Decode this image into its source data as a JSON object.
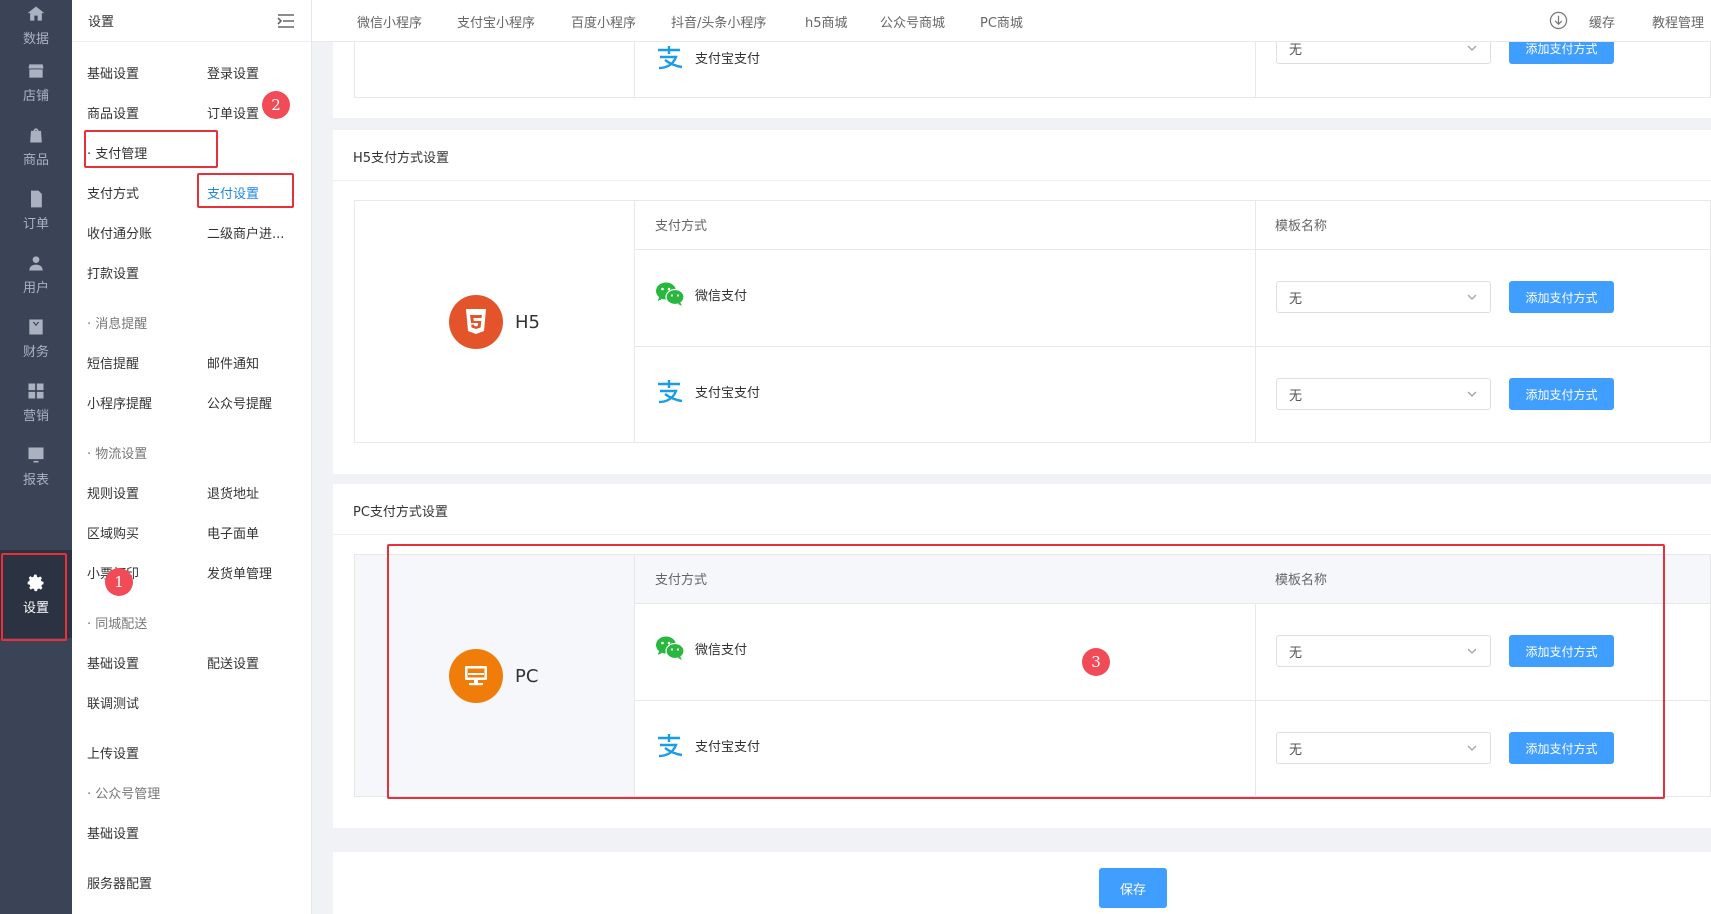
{
  "rail": {
    "items": [
      {
        "label": "数据",
        "icon": "home-icon"
      },
      {
        "label": "店铺",
        "icon": "store-icon"
      },
      {
        "label": "商品",
        "icon": "bag-icon"
      },
      {
        "label": "订单",
        "icon": "document-icon"
      },
      {
        "label": "用户",
        "icon": "user-icon"
      },
      {
        "label": "财务",
        "icon": "yen-icon"
      },
      {
        "label": "营销",
        "icon": "grid-icon"
      },
      {
        "label": "报表",
        "icon": "chart-icon"
      },
      {
        "label": "设置",
        "icon": "gear-icon"
      }
    ]
  },
  "submenu": {
    "title": "设置",
    "links": {
      "basic": "基础设置",
      "login": "登录设置",
      "goods": "商品设置",
      "order": "订单设置",
      "pay_group": "· 支付管理",
      "pay_method": "支付方式",
      "pay_setting": "支付设置",
      "split": "收付通分账",
      "sub_merchant": "二级商户进...",
      "transfer": "打款设置",
      "msg_group": "· 消息提醒",
      "sms": "短信提醒",
      "mail": "邮件通知",
      "mini_remind": "小程序提醒",
      "mp_remind": "公众号提醒",
      "logistics_group": "· 物流设置",
      "rule": "规则设置",
      "return_addr": "退货地址",
      "region": "区域购买",
      "e_sheet": "电子面单",
      "ticket_print": "小票打印",
      "ship_manage": "发货单管理",
      "city_group": "· 同城配送",
      "city_basic": "基础设置",
      "city_delivery": "配送设置",
      "joint_test": "联调测试",
      "upload": "上传设置",
      "mp_group": "· 公众号管理",
      "mp_basic": "基础设置",
      "server": "服务器配置"
    }
  },
  "topbar": {
    "tabs": [
      "微信小程序",
      "支付宝小程序",
      "百度小程序",
      "抖音/头条小程序",
      "h5商城",
      "公众号商城",
      "PC商城"
    ],
    "cache": "缓存",
    "tutorial": "教程管理"
  },
  "sections": {
    "h5_title": "H5支付方式设置",
    "pc_title": "PC支付方式设置",
    "col_method": "支付方式",
    "col_template": "模板名称",
    "h5_label": "H5",
    "pc_label": "PC",
    "wechat": "微信支付",
    "alipay": "支付宝支付",
    "select_value": "无",
    "add_label": "添加支付方式",
    "save_label": "保存"
  },
  "annotations": [
    "1",
    "2",
    "3"
  ],
  "colors": {
    "accent": "#409eff",
    "highlight": "#e8303a",
    "h5_badge": "#e4542b",
    "pc_badge": "#f07c0a",
    "wechat": "#28b83d",
    "alipay": "#1a9de6"
  }
}
